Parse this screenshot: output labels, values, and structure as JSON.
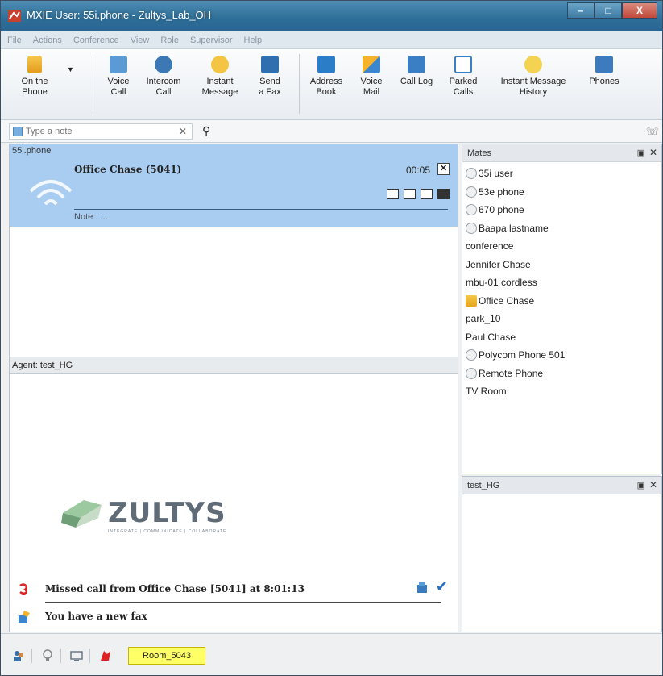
{
  "window": {
    "title": "MXIE User: 55i.phone - Zultys_Lab_OH",
    "buttons": {
      "minimize": "–",
      "maximize": "□",
      "close": "X"
    }
  },
  "menu": [
    "File",
    "Actions",
    "Conference",
    "View",
    "Role",
    "Supervisor",
    "Help"
  ],
  "toolbar": {
    "presence": "On the Phone",
    "voice_call": "Voice Call",
    "intercom_call": "Intercom Call",
    "instant_message": "Instant Message",
    "send_fax": "Send a Fax",
    "address_book": "Address Book",
    "voice_mail": "Voice Mail",
    "call_log": "Call Log",
    "parked_calls": "Parked Calls",
    "im_history": "Instant Message History",
    "phones": "Phones"
  },
  "notebar": {
    "placeholder": "Type a note"
  },
  "call_panel": {
    "header": "55i.phone",
    "caller": "Office Chase (5041)",
    "timer": "00:05",
    "note": "Note:: ..."
  },
  "agent": {
    "label": "Agent: test_HG"
  },
  "logo": {
    "word": "ZULTYS",
    "tagline": "INTEGRATE | COMMUNICATE | COLLABORATE"
  },
  "notifications": {
    "missed_call": "Missed call from Office Chase [5041] at 8:01:13",
    "fax": "You have a new fax"
  },
  "mates": {
    "title": "Mates",
    "items": [
      {
        "name": "35i user",
        "status": "idle"
      },
      {
        "name": "53e phone",
        "status": "idle"
      },
      {
        "name": "670 phone",
        "status": "idle"
      },
      {
        "name": "Baapa lastname",
        "status": "idle"
      },
      {
        "name": "conference",
        "status": "none"
      },
      {
        "name": "Jennifer Chase",
        "status": "none"
      },
      {
        "name": "mbu-01 cordless",
        "status": "none"
      },
      {
        "name": "Office Chase",
        "status": "on-call"
      },
      {
        "name": "park_10",
        "status": "none"
      },
      {
        "name": "Paul Chase",
        "status": "none"
      },
      {
        "name": "Polycom Phone 501",
        "status": "idle"
      },
      {
        "name": "Remote Phone",
        "status": "idle"
      },
      {
        "name": "TV Room",
        "status": "none"
      }
    ]
  },
  "test_hg": {
    "title": "test_HG"
  },
  "statusbar": {
    "room": "Room_5043"
  },
  "colors": {
    "call_card": "#a9cdf0",
    "title_bar": "#2d6e98",
    "room_highlight": "#ffff66"
  }
}
